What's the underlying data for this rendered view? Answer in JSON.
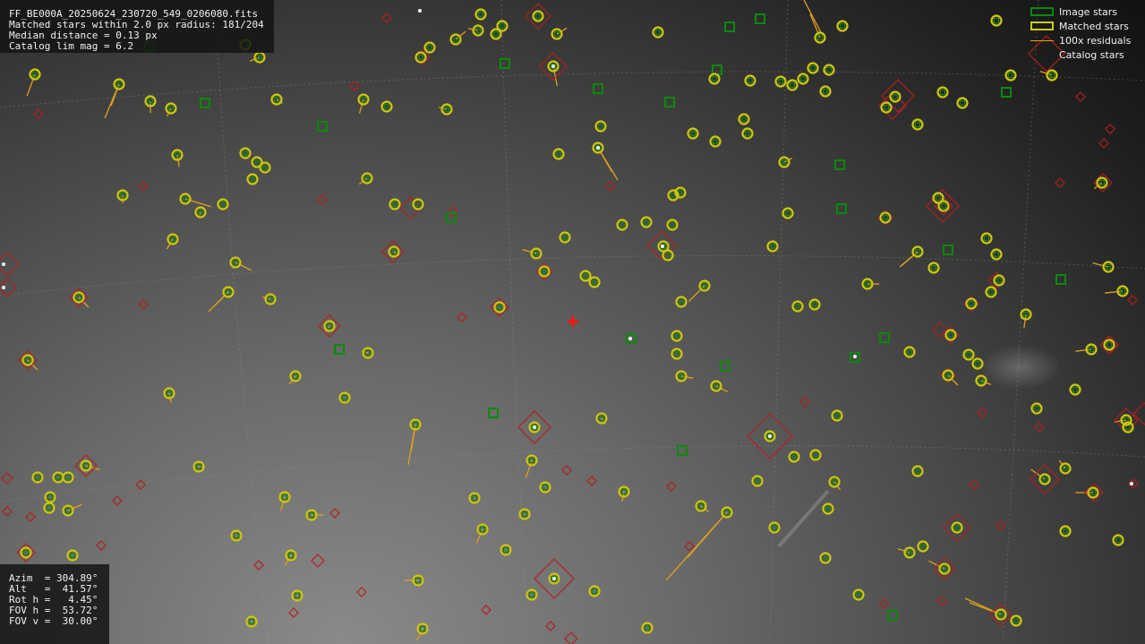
{
  "header": {
    "filename": "FF_BE000A_20250624_230720_549_0206080.fits",
    "line2": "Matched stars within 2.0 px radius: 181/204",
    "line3": "Median distance = 0.13 px",
    "line4": "Catalog lim mag = 6.2"
  },
  "pointing": {
    "azim": "Azim  = 304.89°",
    "alt": "Alt   =  41.57°",
    "rot": "Rot h =   4.45°",
    "fov_h": "FOV h =  53.72°",
    "fov_v": "FOV v =  30.00°"
  },
  "legend": {
    "image_stars": "Image stars",
    "matched_stars": "Matched stars",
    "residuals": "100x residuals",
    "catalog_stars": "Catalog stars"
  },
  "colors": {
    "image_star": "#0a8a0a",
    "matched_star": "#c8c810",
    "residual": "#e0a020",
    "catalog_star": "#b02020",
    "center_marker": "#ff1010"
  },
  "stars": {
    "matched": [
      [
        39,
        83,
        -4,
        11
      ],
      [
        133,
        94,
        -4,
        11
      ],
      [
        168,
        113,
        0,
        6
      ],
      [
        191,
        121,
        -2,
        4
      ],
      [
        198,
        173,
        1,
        6
      ],
      [
        137,
        218,
        0,
        4
      ],
      [
        193,
        267,
        -3,
        5
      ],
      [
        88,
        332,
        5,
        5
      ],
      [
        31,
        402,
        5,
        5
      ],
      [
        189,
        439,
        1,
        5
      ],
      [
        96,
        520,
        7,
        2
      ],
      [
        42,
        533,
        0,
        0
      ],
      [
        65,
        533,
        0,
        0
      ],
      [
        76,
        533,
        0,
        0
      ],
      [
        56,
        555,
        0,
        0
      ],
      [
        55,
        567,
        0,
        0
      ],
      [
        76,
        570,
        7,
        -3
      ],
      [
        29,
        617,
        0,
        0
      ],
      [
        81,
        620,
        0,
        0
      ],
      [
        222,
        521,
        3,
        0
      ],
      [
        264,
        598,
        0,
        0
      ],
      [
        318,
        555,
        -2,
        7
      ],
      [
        348,
        575,
        6,
        0
      ],
      [
        325,
        620,
        -3,
        5
      ],
      [
        332,
        665,
        0,
        0
      ],
      [
        281,
        694,
        0,
        0
      ],
      [
        302,
        334,
        -4,
        -1
      ],
      [
        255,
        326,
        -7,
        7
      ],
      [
        263,
        293,
        8,
        4
      ],
      [
        224,
        237,
        -1,
        3
      ],
      [
        207,
        222,
        13,
        4
      ],
      [
        249,
        228,
        0,
        0
      ],
      [
        274,
        171,
        0,
        0
      ],
      [
        287,
        181,
        0,
        0
      ],
      [
        296,
        187,
        0,
        0
      ],
      [
        282,
        200,
        0,
        0
      ],
      [
        309,
        111,
        3,
        2
      ],
      [
        290,
        64,
        -5,
        2
      ],
      [
        274,
        50,
        0,
        0
      ],
      [
        368,
        364,
        -2,
        3
      ],
      [
        411,
        394,
        -3,
        -1
      ],
      [
        385,
        444,
        0,
        0
      ],
      [
        330,
        420,
        -3,
        4
      ],
      [
        410,
        199,
        -4,
        3
      ],
      [
        440,
        281,
        3,
        2
      ],
      [
        441,
        228,
        0,
        0
      ],
      [
        467,
        228,
        0,
        0
      ],
      [
        432,
        119,
        0,
        0
      ],
      [
        406,
        111,
        -2,
        7
      ],
      [
        499,
        122,
        -4,
        -1
      ],
      [
        470,
        64,
        0,
        0
      ],
      [
        480,
        53,
        0,
        0
      ],
      [
        509,
        44,
        5,
        -4
      ],
      [
        534,
        34,
        -5,
        -1
      ],
      [
        554,
        38,
        0,
        0
      ],
      [
        561,
        29,
        0,
        0
      ],
      [
        537,
        16,
        0,
        0
      ],
      [
        601,
        18,
        0,
        0
      ],
      [
        622,
        38,
        5,
        -3
      ],
      [
        618,
        74,
        2,
        10
      ],
      [
        671,
        141,
        0,
        0
      ],
      [
        668,
        165,
        7,
        12
      ],
      [
        624,
        172,
        0,
        0
      ],
      [
        631,
        265,
        0,
        0
      ],
      [
        599,
        283,
        -7,
        -2
      ],
      [
        608,
        303,
        0,
        0
      ],
      [
        654,
        308,
        0,
        0
      ],
      [
        664,
        315,
        0,
        0
      ],
      [
        558,
        343,
        0,
        0
      ],
      [
        695,
        251,
        0,
        0
      ],
      [
        722,
        248,
        0,
        0
      ],
      [
        751,
        251,
        0,
        0
      ],
      [
        741,
        275,
        0,
        0
      ],
      [
        746,
        285,
        0,
        0
      ],
      [
        752,
        218,
        0,
        0
      ],
      [
        760,
        215,
        0,
        0
      ],
      [
        774,
        149,
        0,
        0
      ],
      [
        799,
        158,
        0,
        0
      ],
      [
        798,
        88,
        0,
        0
      ],
      [
        735,
        36,
        0,
        0
      ],
      [
        831,
        133,
        0,
        0
      ],
      [
        835,
        149,
        0,
        0
      ],
      [
        838,
        90,
        0,
        0
      ],
      [
        872,
        91,
        0,
        0
      ],
      [
        885,
        95,
        0,
        0
      ],
      [
        897,
        88,
        0,
        0
      ],
      [
        908,
        76,
        0,
        0
      ],
      [
        926,
        78,
        0,
        0
      ],
      [
        922,
        102,
        0,
        0
      ],
      [
        916,
        42,
        -5,
        -12
      ],
      [
        941,
        29,
        0,
        0
      ],
      [
        876,
        181,
        4,
        -2
      ],
      [
        880,
        238,
        0,
        0
      ],
      [
        863,
        275,
        0,
        0
      ],
      [
        787,
        319,
        -8,
        8
      ],
      [
        761,
        337,
        0,
        0
      ],
      [
        756,
        375,
        0,
        0
      ],
      [
        756,
        395,
        0,
        0
      ],
      [
        761,
        420,
        6,
        1
      ],
      [
        800,
        431,
        6,
        3
      ],
      [
        672,
        467,
        2,
        3
      ],
      [
        597,
        477,
        0,
        0
      ],
      [
        594,
        514,
        -3,
        9
      ],
      [
        609,
        544,
        0,
        0
      ],
      [
        586,
        574,
        0,
        0
      ],
      [
        565,
        614,
        0,
        0
      ],
      [
        539,
        591,
        -3,
        7
      ],
      [
        530,
        556,
        0,
        0
      ],
      [
        464,
        474,
        -2,
        13
      ],
      [
        467,
        648,
        -7,
        0
      ],
      [
        472,
        702,
        -3,
        6
      ],
      [
        594,
        664,
        0,
        0
      ],
      [
        619,
        646,
        0,
        0
      ],
      [
        664,
        660,
        0,
        0
      ],
      [
        723,
        701,
        0,
        0
      ],
      [
        697,
        549,
        -1,
        5
      ],
      [
        783,
        565,
        4,
        3
      ],
      [
        812,
        572,
        -20,
        23
      ],
      [
        860,
        487,
        0,
        0
      ],
      [
        846,
        537,
        0,
        0
      ],
      [
        865,
        589,
        0,
        0
      ],
      [
        887,
        510,
        0,
        0
      ],
      [
        911,
        508,
        0,
        0
      ],
      [
        932,
        538,
        3,
        4
      ],
      [
        925,
        568,
        0,
        0
      ],
      [
        922,
        623,
        0,
        0
      ],
      [
        935,
        464,
        0,
        0
      ],
      [
        959,
        664,
        0,
        0
      ],
      [
        891,
        342,
        0,
        0
      ],
      [
        910,
        340,
        0,
        0
      ],
      [
        969,
        317,
        6,
        0
      ],
      [
        989,
        243,
        0,
        0
      ],
      [
        1016,
        393,
        0,
        0
      ],
      [
        1025,
        281,
        -8,
        7
      ],
      [
        1043,
        299,
        0,
        0
      ],
      [
        1054,
        230,
        0,
        0
      ],
      [
        1048,
        221,
        0,
        0
      ],
      [
        1062,
        374,
        0,
        0
      ],
      [
        1059,
        419,
        5,
        5
      ],
      [
        1082,
        396,
        0,
        0
      ],
      [
        1092,
        406,
        0,
        0
      ],
      [
        1096,
        425,
        5,
        2
      ],
      [
        1085,
        339,
        0,
        0
      ],
      [
        1107,
        326,
        0,
        0
      ],
      [
        1116,
        313,
        0,
        0
      ],
      [
        1113,
        284,
        0,
        0
      ],
      [
        1102,
        266,
        0,
        0
      ],
      [
        1146,
        351,
        -1,
        7
      ],
      [
        1158,
        456,
        0,
        0
      ],
      [
        1201,
        435,
        0,
        0
      ],
      [
        1219,
        390,
        -8,
        1
      ],
      [
        1239,
        385,
        0,
        0
      ],
      [
        1258,
        469,
        -6,
        1
      ],
      [
        1260,
        477,
        0,
        0
      ],
      [
        1167,
        535,
        -7,
        -5
      ],
      [
        1190,
        523,
        -3,
        -4
      ],
      [
        1221,
        550,
        -9,
        0
      ],
      [
        1190,
        593,
        0,
        0
      ],
      [
        1249,
        603,
        0,
        0
      ],
      [
        1254,
        325,
        -9,
        1
      ],
      [
        1238,
        298,
        -8,
        -2
      ],
      [
        1231,
        204,
        -4,
        3
      ],
      [
        1025,
        526,
        0,
        0
      ],
      [
        1069,
        589,
        0,
        0
      ],
      [
        1031,
        610,
        0,
        0
      ],
      [
        1016,
        617,
        -6,
        -2
      ],
      [
        1055,
        635,
        -8,
        -4
      ],
      [
        1118,
        686,
        -16,
        -6
      ],
      [
        1135,
        693,
        0,
        0
      ],
      [
        1025,
        139,
        0,
        0
      ],
      [
        1000,
        108,
        0,
        0
      ],
      [
        990,
        120,
        0,
        0
      ],
      [
        1053,
        103,
        0,
        0
      ],
      [
        1075,
        115,
        0,
        0
      ],
      [
        1129,
        84,
        0,
        0
      ],
      [
        1175,
        84,
        -6,
        -2
      ],
      [
        1113,
        23,
        0,
        0
      ]
    ],
    "image_only": [
      [
        167,
        52
      ],
      [
        229,
        115
      ],
      [
        360,
        141
      ],
      [
        379,
        390
      ],
      [
        504,
        243
      ],
      [
        551,
        461
      ],
      [
        564,
        71
      ],
      [
        668,
        99
      ],
      [
        748,
        114
      ],
      [
        801,
        78
      ],
      [
        815,
        30
      ],
      [
        849,
        21
      ],
      [
        938,
        184
      ],
      [
        940,
        233
      ],
      [
        988,
        377
      ],
      [
        955,
        399
      ],
      [
        1059,
        279
      ],
      [
        1185,
        312
      ],
      [
        1124,
        103
      ],
      [
        997,
        687
      ],
      [
        762,
        503
      ],
      [
        810,
        409
      ],
      [
        705,
        378
      ]
    ],
    "catalog_only": [
      [
        43,
        127,
        5
      ],
      [
        160,
        208,
        5
      ],
      [
        160,
        340,
        5
      ],
      [
        360,
        223,
        5
      ],
      [
        396,
        96,
        5
      ],
      [
        432,
        20,
        5
      ],
      [
        516,
        354,
        5
      ],
      [
        506,
        236,
        5
      ],
      [
        682,
        208,
        5
      ],
      [
        633,
        525,
        5
      ],
      [
        661,
        537,
        5
      ],
      [
        750,
        543,
        5
      ],
      [
        157,
        541,
        5
      ],
      [
        131,
        559,
        5
      ],
      [
        113,
        609,
        5
      ],
      [
        8,
        571,
        5
      ],
      [
        8,
        534,
        6
      ],
      [
        34,
        577,
        5
      ],
      [
        289,
        631,
        5
      ],
      [
        355,
        626,
        7
      ],
      [
        404,
        661,
        5
      ],
      [
        543,
        681,
        5
      ],
      [
        615,
        699,
        5
      ],
      [
        638,
        713,
        7
      ],
      [
        328,
        684,
        5
      ],
      [
        899,
        449,
        5
      ],
      [
        1097,
        461,
        5
      ],
      [
        1088,
        541,
        5
      ],
      [
        1118,
        587,
        5
      ],
      [
        987,
        674,
        5
      ],
      [
        1052,
        671,
        5
      ],
      [
        1207,
        108,
        5
      ],
      [
        1233,
        160,
        5
      ],
      [
        1240,
        144,
        5
      ],
      [
        1184,
        204,
        5
      ],
      [
        1265,
        335,
        5
      ],
      [
        1161,
        477,
        5
      ],
      [
        374,
        573,
        5
      ],
      [
        770,
        610,
        5
      ],
      [
        1266,
        540,
        5
      ]
    ],
    "large_catalog": [
      [
        601,
        18,
        14
      ],
      [
        618,
        74,
        15
      ],
      [
        1003,
        107,
        18
      ],
      [
        997,
        118,
        15
      ],
      [
        1053,
        230,
        18
      ],
      [
        739,
        274,
        16
      ],
      [
        439,
        281,
        12
      ],
      [
        608,
        303,
        9
      ],
      [
        558,
        343,
        10
      ],
      [
        368,
        364,
        12
      ],
      [
        597,
        477,
        18
      ],
      [
        860,
        487,
        25
      ],
      [
        1167,
        535,
        16
      ],
      [
        1069,
        589,
        15
      ],
      [
        619,
        646,
        22
      ],
      [
        1055,
        635,
        12
      ],
      [
        1118,
        686,
        12
      ],
      [
        96,
        520,
        12
      ],
      [
        29,
        617,
        10
      ],
      [
        31,
        402,
        10
      ],
      [
        8,
        295,
        13
      ],
      [
        8,
        321,
        10
      ],
      [
        1169,
        60,
        20
      ],
      [
        1054,
        230,
        10
      ],
      [
        1232,
        204,
        10
      ],
      [
        1239,
        385,
        10
      ],
      [
        88,
        332,
        10
      ],
      [
        459,
        232,
        12
      ],
      [
        472,
        64,
        8
      ],
      [
        1085,
        339,
        8
      ],
      [
        1113,
        313,
        9
      ],
      [
        989,
        243,
        8
      ],
      [
        1059,
        419,
        8
      ],
      [
        1062,
        374,
        9
      ],
      [
        1258,
        469,
        13
      ],
      [
        1278,
        462,
        12
      ],
      [
        1222,
        550,
        10
      ],
      [
        1050,
        368,
        8
      ],
      [
        1241,
        385,
        8
      ]
    ],
    "bright_dots": [
      [
        469,
        12
      ],
      [
        618,
        74
      ],
      [
        668,
        165
      ],
      [
        4,
        295
      ],
      [
        4,
        321
      ],
      [
        704,
        378
      ],
      [
        955,
        398
      ],
      [
        860,
        487
      ],
      [
        597,
        477
      ],
      [
        619,
        646
      ],
      [
        740,
        275
      ],
      [
        1264,
        540
      ]
    ]
  }
}
